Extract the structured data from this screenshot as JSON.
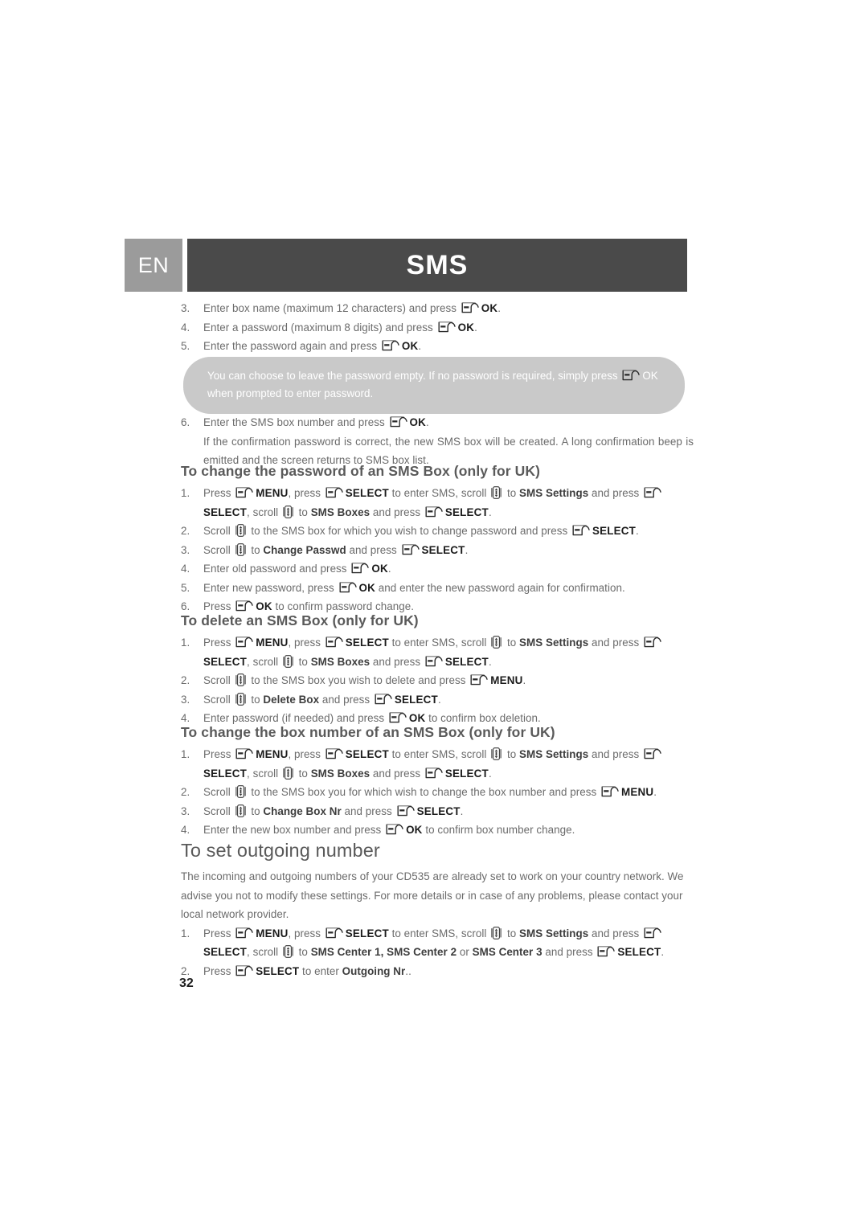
{
  "header": {
    "language_badge": "EN",
    "title": "SMS"
  },
  "icons": {
    "softkey": "softkey-icon",
    "scroll": "scroll-icon"
  },
  "top_steps": [
    {
      "num": "3.",
      "parts": [
        {
          "t": "Enter box name (maximum 12 characters) and press "
        },
        {
          "icon": "softkey"
        },
        {
          "t": "OK",
          "b": true
        },
        {
          "t": "."
        }
      ]
    },
    {
      "num": "4.",
      "parts": [
        {
          "t": "Enter a password (maximum 8 digits) and press "
        },
        {
          "icon": "softkey"
        },
        {
          "t": "OK",
          "b": true
        },
        {
          "t": "."
        }
      ]
    },
    {
      "num": "5.",
      "parts": [
        {
          "t": "Enter the password again and press "
        },
        {
          "icon": "softkey"
        },
        {
          "t": "OK",
          "b": true
        },
        {
          "t": "."
        }
      ]
    }
  ],
  "callout": {
    "line1_a": "You can choose to leave the password empty. If no password is required, simply press ",
    "line1_b": "OK",
    "line2": "when prompted to enter password."
  },
  "step6": {
    "num": "6.",
    "lead": "Enter the SMS box number and press ",
    "ok": "OK",
    "tail": ".",
    "body": "If the confirmation password is correct, the new SMS box will be created. A long confirmation beep is emitted and the screen returns to SMS box list."
  },
  "sections": [
    {
      "id": "change-password",
      "heading": "To change the password of an SMS Box (only for UK)",
      "steps": [
        {
          "num": "1.",
          "parts": [
            {
              "t": "Press "
            },
            {
              "icon": "softkey"
            },
            {
              "t": "MENU",
              "b": true
            },
            {
              "t": ", press "
            },
            {
              "icon": "softkey"
            },
            {
              "t": "SELECT",
              "b": true
            },
            {
              "t": " to enter SMS, scroll "
            },
            {
              "icon": "scroll"
            },
            {
              "t": " to "
            },
            {
              "t": "SMS Settings",
              "s": true
            },
            {
              "t": " and press "
            },
            {
              "icon": "softkey"
            },
            {
              "t": "SELECT",
              "b": true
            },
            {
              "t": ", scroll "
            },
            {
              "icon": "scroll"
            },
            {
              "t": " to "
            },
            {
              "t": "SMS Boxes",
              "s": true
            },
            {
              "t": " and press "
            },
            {
              "icon": "softkey"
            },
            {
              "t": "SELECT",
              "b": true
            },
            {
              "t": "."
            }
          ]
        },
        {
          "num": "2.",
          "parts": [
            {
              "t": "Scroll "
            },
            {
              "icon": "scroll"
            },
            {
              "t": " to the SMS box for which you wish to change password and press "
            },
            {
              "icon": "softkey"
            },
            {
              "t": "SELECT",
              "b": true
            },
            {
              "t": "."
            }
          ]
        },
        {
          "num": "3.",
          "parts": [
            {
              "t": "Scroll "
            },
            {
              "icon": "scroll"
            },
            {
              "t": " to "
            },
            {
              "t": "Change Passwd",
              "s": true
            },
            {
              "t": " and press "
            },
            {
              "icon": "softkey"
            },
            {
              "t": "SELECT",
              "b": true
            },
            {
              "t": "."
            }
          ]
        },
        {
          "num": "4.",
          "parts": [
            {
              "t": "Enter old password and press "
            },
            {
              "icon": "softkey"
            },
            {
              "t": "OK",
              "b": true
            },
            {
              "t": "."
            }
          ]
        },
        {
          "num": "5.",
          "parts": [
            {
              "t": "Enter new password, press "
            },
            {
              "icon": "softkey"
            },
            {
              "t": "OK",
              "b": true
            },
            {
              "t": " and enter the new password again for confirmation."
            }
          ]
        },
        {
          "num": "6.",
          "parts": [
            {
              "t": "Press "
            },
            {
              "icon": "softkey"
            },
            {
              "t": "OK",
              "b": true
            },
            {
              "t": " to confirm password change."
            }
          ]
        }
      ]
    },
    {
      "id": "delete-box",
      "heading": "To delete an SMS Box (only for UK)",
      "steps": [
        {
          "num": "1.",
          "parts": [
            {
              "t": "Press "
            },
            {
              "icon": "softkey"
            },
            {
              "t": "MENU",
              "b": true
            },
            {
              "t": ", press "
            },
            {
              "icon": "softkey"
            },
            {
              "t": "SELECT",
              "b": true
            },
            {
              "t": " to enter SMS, scroll "
            },
            {
              "icon": "scroll"
            },
            {
              "t": " to "
            },
            {
              "t": "SMS Settings",
              "s": true
            },
            {
              "t": " and press "
            },
            {
              "icon": "softkey"
            },
            {
              "t": "SELECT",
              "b": true
            },
            {
              "t": ", scroll "
            },
            {
              "icon": "scroll"
            },
            {
              "t": " to "
            },
            {
              "t": "SMS Boxes",
              "s": true
            },
            {
              "t": " and press "
            },
            {
              "icon": "softkey"
            },
            {
              "t": "SELECT",
              "b": true
            },
            {
              "t": "."
            }
          ]
        },
        {
          "num": "2.",
          "parts": [
            {
              "t": "Scroll "
            },
            {
              "icon": "scroll"
            },
            {
              "t": " to the SMS box you wish to delete and press "
            },
            {
              "icon": "softkey"
            },
            {
              "t": "MENU",
              "b": true
            },
            {
              "t": "."
            }
          ]
        },
        {
          "num": "3.",
          "parts": [
            {
              "t": "Scroll "
            },
            {
              "icon": "scroll"
            },
            {
              "t": " to "
            },
            {
              "t": "Delete Box",
              "s": true
            },
            {
              "t": " and press "
            },
            {
              "icon": "softkey"
            },
            {
              "t": "SELECT",
              "b": true
            },
            {
              "t": "."
            }
          ]
        },
        {
          "num": "4.",
          "parts": [
            {
              "t": "Enter password (if needed) and press "
            },
            {
              "icon": "softkey"
            },
            {
              "t": "OK",
              "b": true
            },
            {
              "t": " to confirm box deletion."
            }
          ]
        }
      ]
    },
    {
      "id": "change-box-number",
      "heading": "To change the box number of an SMS Box (only for UK)",
      "steps": [
        {
          "num": "1.",
          "parts": [
            {
              "t": "Press "
            },
            {
              "icon": "softkey"
            },
            {
              "t": "MENU",
              "b": true
            },
            {
              "t": ", press "
            },
            {
              "icon": "softkey"
            },
            {
              "t": "SELECT",
              "b": true
            },
            {
              "t": " to enter SMS, scroll "
            },
            {
              "icon": "scroll"
            },
            {
              "t": " to "
            },
            {
              "t": "SMS Settings",
              "s": true
            },
            {
              "t": " and press "
            },
            {
              "icon": "softkey"
            },
            {
              "t": "SELECT",
              "b": true
            },
            {
              "t": ", scroll "
            },
            {
              "icon": "scroll"
            },
            {
              "t": " to "
            },
            {
              "t": "SMS Boxes",
              "s": true
            },
            {
              "t": " and press "
            },
            {
              "icon": "softkey"
            },
            {
              "t": "SELECT",
              "b": true
            },
            {
              "t": "."
            }
          ]
        },
        {
          "num": "2.",
          "parts": [
            {
              "t": "Scroll "
            },
            {
              "icon": "scroll"
            },
            {
              "t": " to the SMS box you for which wish to change the box number and press "
            },
            {
              "icon": "softkey"
            },
            {
              "t": "MENU",
              "b": true
            },
            {
              "t": "."
            }
          ]
        },
        {
          "num": "3.",
          "parts": [
            {
              "t": "Scroll "
            },
            {
              "icon": "scroll"
            },
            {
              "t": " to "
            },
            {
              "t": "Change Box Nr",
              "s": true
            },
            {
              "t": " and press "
            },
            {
              "icon": "softkey"
            },
            {
              "t": "SELECT",
              "b": true
            },
            {
              "t": "."
            }
          ]
        },
        {
          "num": "4.",
          "parts": [
            {
              "t": "Enter the new box number and press "
            },
            {
              "icon": "softkey"
            },
            {
              "t": "OK",
              "b": true
            },
            {
              "t": " to confirm box number change."
            }
          ]
        }
      ]
    }
  ],
  "outgoing": {
    "heading": "To set outgoing number",
    "paragraph": "The incoming and outgoing numbers of your CD535 are already set to work on your country network. We advise you not to modify these settings. For more details or in case of any problems, please contact your local network provider.",
    "steps": [
      {
        "num": "1.",
        "parts": [
          {
            "t": "Press "
          },
          {
            "icon": "softkey"
          },
          {
            "t": "MENU",
            "b": true
          },
          {
            "t": ", press "
          },
          {
            "icon": "softkey"
          },
          {
            "t": "SELECT",
            "b": true
          },
          {
            "t": " to enter SMS, scroll "
          },
          {
            "icon": "scroll"
          },
          {
            "t": " to "
          },
          {
            "t": "SMS Settings",
            "s": true
          },
          {
            "t": " and press "
          },
          {
            "icon": "softkey"
          },
          {
            "t": "SELECT",
            "b": true
          },
          {
            "t": ", scroll "
          },
          {
            "icon": "scroll"
          },
          {
            "t": " to "
          },
          {
            "t": "SMS Center 1, SMS Center 2",
            "s": true
          },
          {
            "t": " or "
          },
          {
            "t": "SMS Center 3",
            "s": true
          },
          {
            "t": " and press "
          },
          {
            "icon": "softkey"
          },
          {
            "t": "SELECT",
            "b": true
          },
          {
            "t": "."
          }
        ]
      },
      {
        "num": "2.",
        "parts": [
          {
            "t": "Press "
          },
          {
            "icon": "softkey"
          },
          {
            "t": "SELECT",
            "b": true
          },
          {
            "t": " to enter "
          },
          {
            "t": "Outgoing Nr",
            "s": true
          },
          {
            "t": ".."
          }
        ]
      }
    ]
  },
  "footer": {
    "page_number": "32"
  },
  "colors": {
    "lang_badge_bg": "#9b9b9b",
    "title_bar_bg": "#4a4a4a",
    "callout_bg": "#c9c9c9",
    "body_text": "#6b6b6b",
    "heading_text": "#5a5a5a",
    "bold_text": "#1b1b1b"
  }
}
